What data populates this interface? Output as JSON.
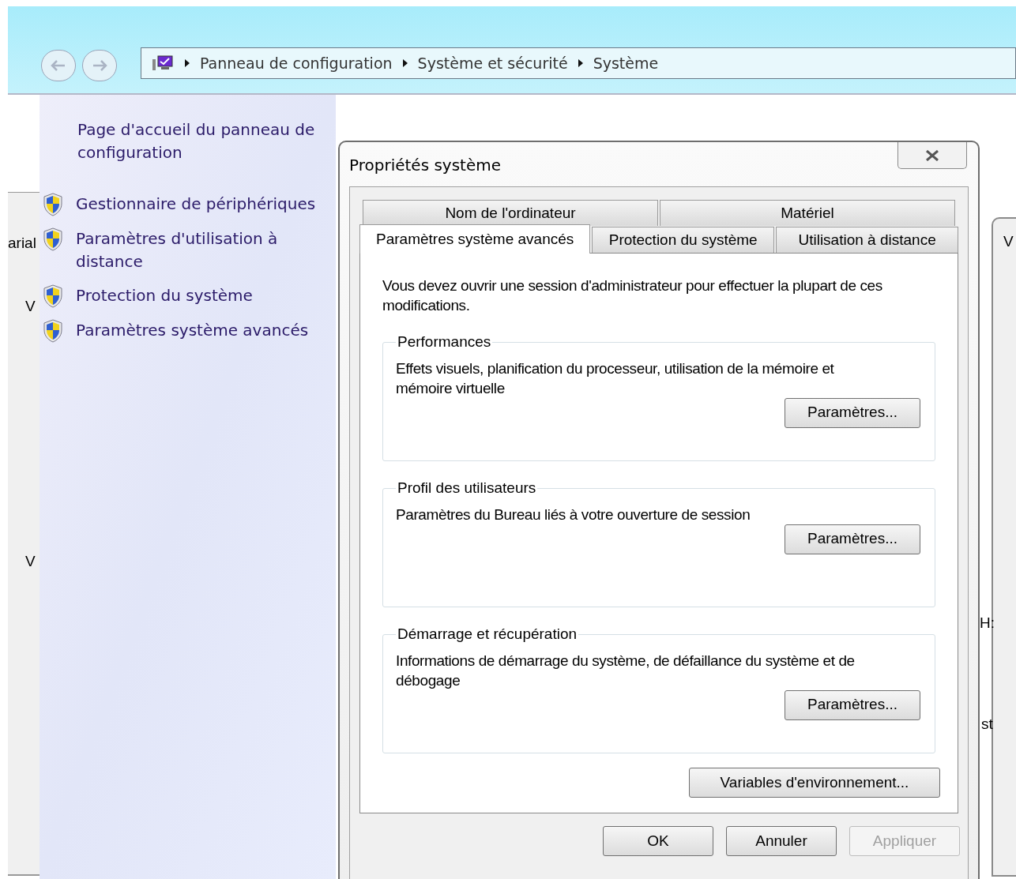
{
  "address_bar": {
    "breadcrumbs": [
      "Panneau de configuration",
      "Système et sécurité",
      "Système"
    ]
  },
  "sidebar": {
    "home_link": "Page d'accueil du panneau de configuration",
    "items": [
      {
        "label": "Gestionnaire de périphériques"
      },
      {
        "label": "Paramètres d'utilisation à distance"
      },
      {
        "label": "Protection du système"
      },
      {
        "label": "Paramètres système avancés"
      }
    ]
  },
  "left_window_fragments": [
    "arial",
    "V",
    "V"
  ],
  "right_window_fragments": [
    "V",
    "H:",
    "st"
  ],
  "dialog": {
    "title": "Propriétés système",
    "tab_rows": [
      [
        {
          "label": "Nom de l'ordinateur",
          "selected": false
        },
        {
          "label": "Matériel",
          "selected": false
        }
      ],
      [
        {
          "label": "Paramètres système avancés",
          "selected": true
        },
        {
          "label": "Protection du système",
          "selected": false
        },
        {
          "label": "Utilisation à distance",
          "selected": false
        }
      ]
    ],
    "notice": "Vous devez ouvrir une session d'administrateur pour effectuer la plupart de ces modifications.",
    "groups": [
      {
        "title": "Performances",
        "description": "Effets visuels, planification du processeur, utilisation de la mémoire et mémoire virtuelle",
        "button": "Paramètres..."
      },
      {
        "title": "Profil des utilisateurs",
        "description": "Paramètres du Bureau liés à votre ouverture de session",
        "button": "Paramètres..."
      },
      {
        "title": "Démarrage et récupération",
        "description": "Informations de démarrage du système, de défaillance du système et de débogage",
        "button": "Paramètres..."
      }
    ],
    "env_button": "Variables d'environnement...",
    "buttons": [
      {
        "label": "OK",
        "disabled": false
      },
      {
        "label": "Annuler",
        "disabled": false
      },
      {
        "label": "Appliquer",
        "disabled": true
      }
    ]
  }
}
